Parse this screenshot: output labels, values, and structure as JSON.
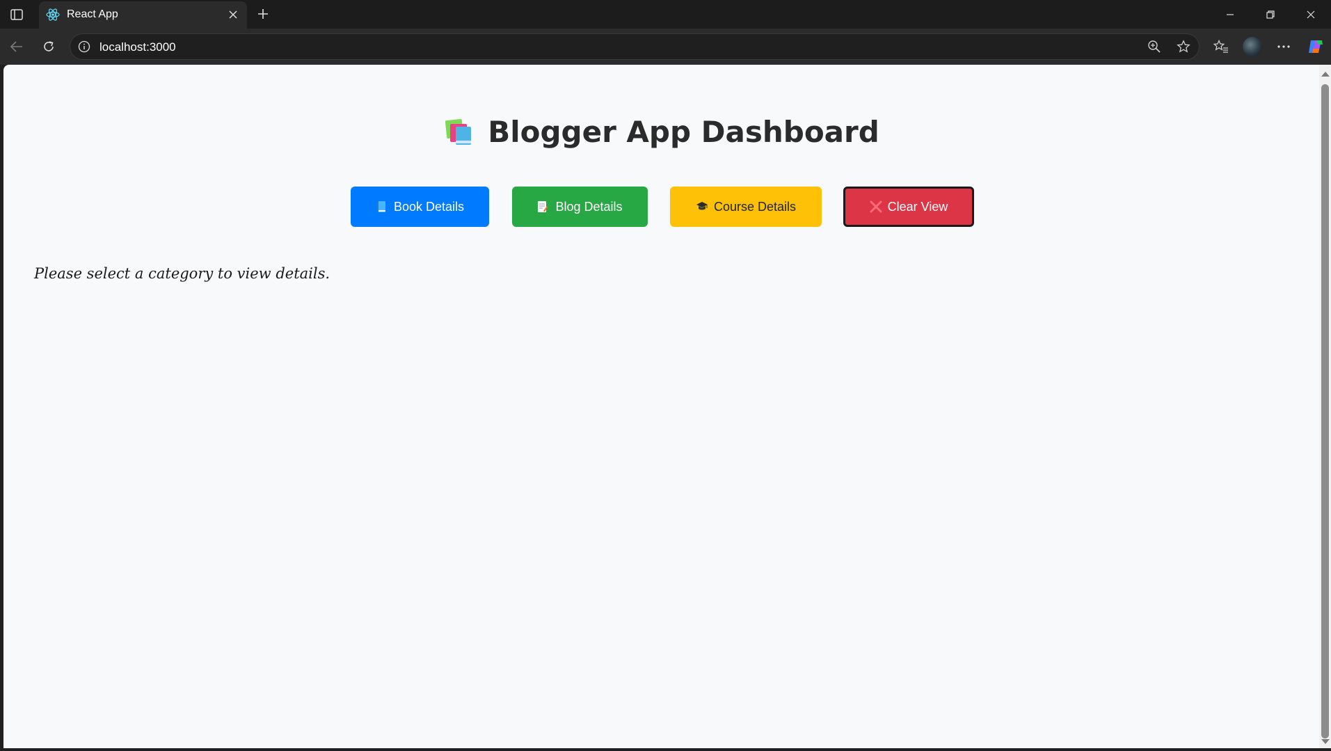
{
  "browser": {
    "tab_title": "React App",
    "address": "localhost:3000",
    "colors": {
      "chrome_bg": "#1c1c1c",
      "toolbar_bg": "#2b2b2b",
      "page_bg": "#f8f9fa"
    }
  },
  "app": {
    "title": "Blogger App Dashboard",
    "buttons": {
      "book": {
        "label": "Book Details",
        "icon": "blue-book-icon",
        "color": "#007bff"
      },
      "blog": {
        "label": "Blog Details",
        "icon": "memo-icon",
        "color": "#28a745"
      },
      "course": {
        "label": "Course Details",
        "icon": "graduation-cap-icon",
        "color": "#ffc107"
      },
      "clear": {
        "label": "Clear View",
        "icon": "cross-mark-icon",
        "color": "#dc3545"
      }
    },
    "placeholder": "Please select a category to view details."
  }
}
